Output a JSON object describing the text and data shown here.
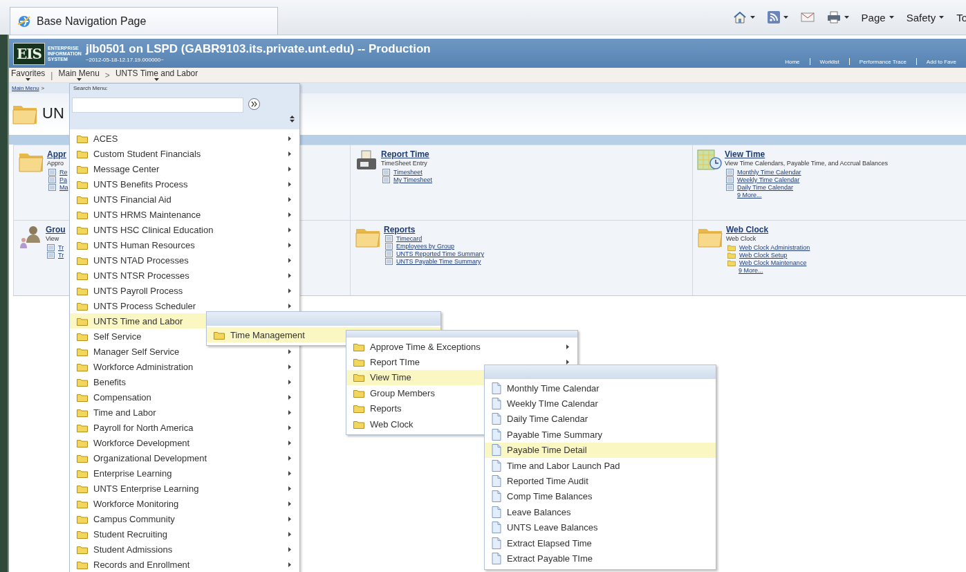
{
  "browser": {
    "tab_title": "Base Navigation Page",
    "commands": [
      {
        "kind": "home",
        "caret": true
      },
      {
        "kind": "feed",
        "caret": true
      },
      {
        "kind": "mail",
        "caret": false
      },
      {
        "kind": "print",
        "caret": true
      },
      {
        "kind": "text",
        "label": "Page",
        "caret": true
      },
      {
        "kind": "text",
        "label": "Safety",
        "caret": true
      },
      {
        "kind": "text",
        "label": "To",
        "caret": false
      }
    ]
  },
  "header": {
    "logo_mark": "EIS",
    "logo_lines": [
      "ENTERPRISE",
      "INFORMATION",
      "SYSTEM"
    ],
    "title": "jlb0501 on LSPD (GABR9103.its.private.unt.edu) -- Production",
    "timestamp": "~2012-05-18-12.17.19.000000~",
    "links": [
      "Home",
      "Worklist",
      "Performance Trace",
      "Add to Fave"
    ]
  },
  "breadcrumb": [
    {
      "label": "Favorites",
      "caret": true
    },
    {
      "label": "Main Menu",
      "separator_before": "|",
      "caret": true
    },
    {
      "label": "UNTS Time and Labor",
      "separator_before": ">",
      "caret": true
    }
  ],
  "page": {
    "crumb_link": "Main Menu",
    "crumb_separator": ">",
    "heading": "UN",
    "tiles": [
      {
        "kind": "folder",
        "title": "Appr",
        "description": "Appro",
        "links": [
          {
            "label": "Re",
            "kind": "page"
          },
          {
            "label": "Pa",
            "kind": "page"
          },
          {
            "label": "Ma",
            "kind": "page"
          }
        ]
      },
      {
        "kind": "printer",
        "title": "Report Time",
        "description": "TimeSheet Entry",
        "links": [
          {
            "label": "Timesheet",
            "kind": "page"
          },
          {
            "label": "My Timesheet",
            "kind": "page"
          }
        ]
      },
      {
        "kind": "calendar",
        "title": "View Time",
        "description": "View Time Calendars, Payable Time, and Accrual Balances",
        "links": [
          {
            "label": "Monthly Time Calendar",
            "kind": "page"
          },
          {
            "label": "Weekly Time Calendar",
            "kind": "page"
          },
          {
            "label": "Daily Time Calendar",
            "kind": "page"
          },
          {
            "label": "9 More...",
            "kind": "more"
          }
        ]
      },
      {
        "kind": "people",
        "title": "Grou",
        "description": "View",
        "links": [
          {
            "label": "Tr",
            "kind": "page"
          },
          {
            "label": "Tr",
            "kind": "page"
          }
        ]
      },
      {
        "kind": "folder",
        "title": "Reports",
        "links": [
          {
            "label": "Timecard",
            "kind": "page"
          },
          {
            "label": "Employees by Group",
            "kind": "page"
          },
          {
            "label": "UNTS Reported Time Summary",
            "kind": "page"
          },
          {
            "label": "UNTS Payable Time Summary",
            "kind": "page"
          }
        ]
      },
      {
        "kind": "folder",
        "title": "Web Clock",
        "description": "Web Clock",
        "links": [
          {
            "label": "Web Clock Administration",
            "kind": "folder"
          },
          {
            "label": "Web Clock Setup",
            "kind": "folder"
          },
          {
            "label": "Web Clock Maintenance",
            "kind": "folder"
          },
          {
            "label": "9 More...",
            "kind": "more"
          }
        ]
      }
    ]
  },
  "menu": {
    "search_label": "Search Menu:",
    "items": [
      {
        "label": "ACES",
        "selected": false
      },
      {
        "label": "Custom Student Financials",
        "selected": false
      },
      {
        "label": "Message Center",
        "selected": false
      },
      {
        "label": "UNTS Benefits Process",
        "selected": false
      },
      {
        "label": "UNTS Financial Aid",
        "selected": false
      },
      {
        "label": "UNTS HRMS Maintenance",
        "selected": false
      },
      {
        "label": "UNTS HSC Clinical Education",
        "selected": false
      },
      {
        "label": "UNTS Human Resources",
        "selected": false
      },
      {
        "label": "UNTS NTAD Processes",
        "selected": false
      },
      {
        "label": "UNTS NTSR Processes",
        "selected": false
      },
      {
        "label": "UNTS Payroll Process",
        "selected": false
      },
      {
        "label": "UNTS Process Scheduler",
        "selected": false
      },
      {
        "label": "UNTS Time and Labor",
        "selected": true
      },
      {
        "label": "Self Service",
        "selected": false
      },
      {
        "label": "Manager Self Service",
        "selected": false
      },
      {
        "label": "Workforce Administration",
        "selected": false
      },
      {
        "label": "Benefits",
        "selected": false
      },
      {
        "label": "Compensation",
        "selected": false
      },
      {
        "label": "Time and Labor",
        "selected": false
      },
      {
        "label": "Payroll for North America",
        "selected": false
      },
      {
        "label": "Workforce Development",
        "selected": false
      },
      {
        "label": "Organizational Development",
        "selected": false
      },
      {
        "label": "Enterprise Learning",
        "selected": false
      },
      {
        "label": "UNTS Enterprise Learning",
        "selected": false
      },
      {
        "label": "Workforce Monitoring",
        "selected": false
      },
      {
        "label": "Campus Community",
        "selected": false
      },
      {
        "label": "Student Recruiting",
        "selected": false
      },
      {
        "label": "Student Admissions",
        "selected": false
      },
      {
        "label": "Records and Enrollment",
        "selected": false
      }
    ]
  },
  "submenus": [
    {
      "items": [
        {
          "label": "Time Management",
          "kind": "folder",
          "selected": true
        }
      ]
    },
    {
      "items": [
        {
          "label": "Approve Time & Exceptions",
          "kind": "folder",
          "selected": false,
          "arrow": true
        },
        {
          "label": "Report TIme",
          "kind": "folder",
          "selected": false,
          "arrow": true
        },
        {
          "label": "View Time",
          "kind": "folder",
          "selected": true
        },
        {
          "label": "Group Members",
          "kind": "folder",
          "selected": false
        },
        {
          "label": "Reports",
          "kind": "folder",
          "selected": false
        },
        {
          "label": "Web Clock",
          "kind": "folder",
          "selected": false
        }
      ]
    },
    {
      "items": [
        {
          "label": "Monthly Time Calendar",
          "kind": "page",
          "selected": false
        },
        {
          "label": "Weekly TIme Calendar",
          "kind": "page",
          "selected": false
        },
        {
          "label": "Daily Time Calendar",
          "kind": "page",
          "selected": false
        },
        {
          "label": "Payable Time Summary",
          "kind": "page",
          "selected": false
        },
        {
          "label": "Payable Time Detail",
          "kind": "page",
          "selected": true
        },
        {
          "label": "Time and Labor Launch Pad",
          "kind": "page",
          "selected": false
        },
        {
          "label": "Reported Time Audit",
          "kind": "page",
          "selected": false
        },
        {
          "label": "Comp Time Balances",
          "kind": "page",
          "selected": false
        },
        {
          "label": "Leave Balances",
          "kind": "page",
          "selected": false
        },
        {
          "label": "UNTS Leave Balances",
          "kind": "page",
          "selected": false
        },
        {
          "label": "Extract Elapsed Time",
          "kind": "page",
          "selected": false
        },
        {
          "label": "Extract Payable TIme",
          "kind": "page",
          "selected": false
        }
      ]
    }
  ]
}
